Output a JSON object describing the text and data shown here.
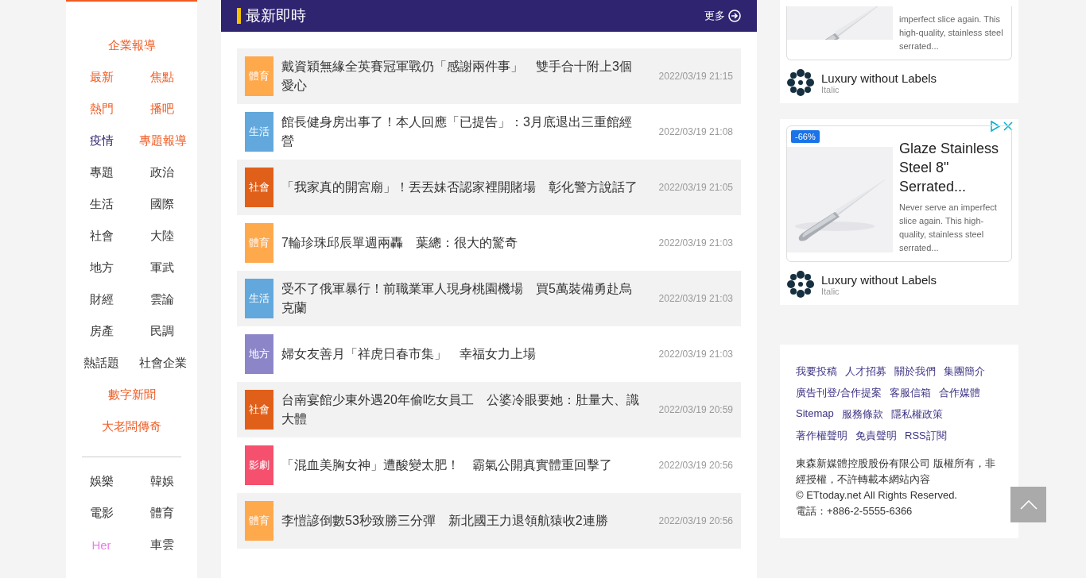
{
  "sidebar": {
    "groups": [
      {
        "rows": [
          [
            {
              "label": "企業報導",
              "kind": "accent"
            }
          ],
          [
            {
              "label": "最新",
              "kind": "accent"
            },
            {
              "label": "焦點",
              "kind": "accent"
            }
          ],
          [
            {
              "label": "熱門",
              "kind": "accent"
            },
            {
              "label": "播吧",
              "kind": "accent"
            }
          ],
          [
            {
              "label": "疫情",
              "kind": "brand"
            },
            {
              "label": "專題報導",
              "kind": "accent"
            }
          ],
          [
            {
              "label": "專題",
              "kind": "plain"
            },
            {
              "label": "政治",
              "kind": "plain"
            }
          ],
          [
            {
              "label": "生活",
              "kind": "plain"
            },
            {
              "label": "國際",
              "kind": "plain"
            }
          ],
          [
            {
              "label": "社會",
              "kind": "plain"
            },
            {
              "label": "大陸",
              "kind": "plain"
            }
          ],
          [
            {
              "label": "地方",
              "kind": "plain"
            },
            {
              "label": "軍武",
              "kind": "plain"
            }
          ],
          [
            {
              "label": "財經",
              "kind": "plain"
            },
            {
              "label": "雲論",
              "kind": "plain"
            }
          ],
          [
            {
              "label": "房產",
              "kind": "plain"
            },
            {
              "label": "民調",
              "kind": "plain"
            }
          ],
          [
            {
              "label": "熱話題",
              "kind": "plain"
            },
            {
              "label": "社會企業",
              "kind": "plain"
            }
          ],
          [
            {
              "label": "數字新聞",
              "kind": "accent"
            }
          ],
          [
            {
              "label": "大老闆傳奇",
              "kind": "accent"
            }
          ]
        ]
      },
      {
        "rows": [
          [
            {
              "label": "娛樂",
              "kind": "plain"
            },
            {
              "label": "韓娛",
              "kind": "plain"
            }
          ],
          [
            {
              "label": "電影",
              "kind": "plain"
            },
            {
              "label": "體育",
              "kind": "plain"
            }
          ],
          [
            {
              "label": "Her",
              "kind": "pink"
            },
            {
              "label": "車雲",
              "kind": "plain"
            }
          ]
        ]
      }
    ]
  },
  "news": {
    "title": "最新即時",
    "more": "更多",
    "items": [
      {
        "category": "體育",
        "color": "#ffa94d",
        "title": "戴資穎無緣全英賽冠軍戰仍「感謝兩件事」　雙手合十附上3個愛心",
        "time": "2022/03/19 21:15"
      },
      {
        "category": "生活",
        "color": "#62a8dc",
        "title": "館長健身房出事了！本人回應「已提告」：3月底退出三重館經營",
        "time": "2022/03/19 21:08"
      },
      {
        "category": "社會",
        "color": "#e0601a",
        "title": "「我家真的開宮廟」！丟丟妹否認家裡開賭場　彰化警方說話了",
        "time": "2022/03/19 21:05"
      },
      {
        "category": "體育",
        "color": "#ffa94d",
        "title": "7輪珍珠邱辰單週兩轟　葉總：很大的驚奇",
        "time": "2022/03/19 21:03"
      },
      {
        "category": "生活",
        "color": "#62a8dc",
        "title": "受不了俄軍暴行！前職業軍人現身桃園機場　買5萬裝備勇赴烏克蘭",
        "time": "2022/03/19 21:03"
      },
      {
        "category": "地方",
        "color": "#8c86c8",
        "title": "婦女友善月「祥虎日春市集」　幸福女力上場",
        "time": "2022/03/19 21:03"
      },
      {
        "category": "社會",
        "color": "#e0601a",
        "title": "台南宴館少東外遇20年偷吃女員工　公婆冷眼要她：肚量大、識大體",
        "time": "2022/03/19 20:59"
      },
      {
        "category": "影劇",
        "color": "#f5506e",
        "title": "「混血美胸女神」遭酸變太肥！　霸氣公開真實體重回擊了",
        "time": "2022/03/19 20:56"
      },
      {
        "category": "體育",
        "color": "#ffa94d",
        "title": "李愷諺倒數53秒致勝三分彈　新北國王力退領航猿收2連勝",
        "time": "2022/03/19 20:56"
      }
    ]
  },
  "ads": [
    {
      "kind": "partial",
      "description": "imperfect slice again. This high-quality, stainless steel serrated...",
      "brand": "Luxury without Labels",
      "brand_sub": "Italic"
    },
    {
      "kind": "full",
      "discount": "-66%",
      "title": "Glaze Stainless Steel 8\" Serrated...",
      "description": "Never serve an imperfect slice again. This high-quality, stainless steel serrated...",
      "brand": "Luxury without Labels",
      "brand_sub": "Italic"
    }
  ],
  "footer": {
    "link_rows": [
      [
        "我要投稿",
        "人才招募",
        "關於我們",
        "集團簡介"
      ],
      [
        "廣告刊登/合作提案",
        "客服信箱",
        "合作媒體"
      ],
      [
        "Sitemap",
        "服務條款",
        "隱私權政策"
      ],
      [
        "著作權聲明",
        "免責聲明",
        "RSS訂閱"
      ]
    ],
    "copyright": "東森新媒體控股股份有限公司 版權所有，非經授權，不許轉載本網站內容",
    "rights": "© ETtoday.net All Rights Reserved.",
    "phone": "電話：+886-2-5555-6366"
  }
}
